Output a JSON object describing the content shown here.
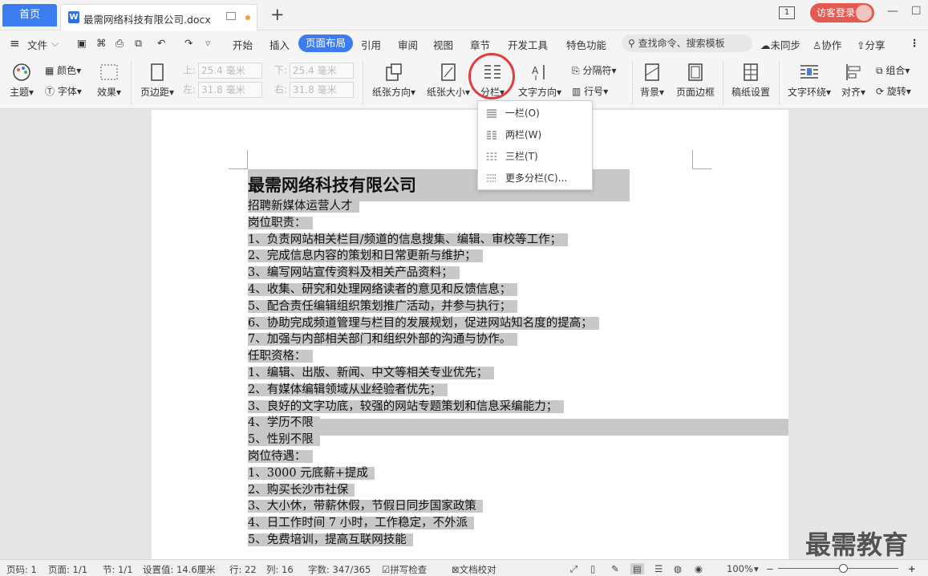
{
  "titlebar": {
    "home_tab": "首页",
    "doc_tab": "最需网络科技有限公司.docx",
    "new_tab": "+",
    "page_indicator": "1",
    "login": "访客登录"
  },
  "menubar": {
    "file": "文件",
    "items": [
      "开始",
      "插入",
      "页面布局",
      "引用",
      "审阅",
      "视图",
      "章节",
      "开发工具",
      "特色功能"
    ],
    "search": "查找命令、搜索模板",
    "sync": "未同步",
    "collab": "协作",
    "share": "分享"
  },
  "ribbon": {
    "theme": "主题",
    "color": "颜色",
    "font": "字体",
    "effect": "效果",
    "margin": "页边距",
    "top_label": "上:",
    "top_val": "25.4 毫米",
    "bottom_label": "下:",
    "bottom_val": "25.4 毫米",
    "left_label": "左:",
    "left_val": "31.8 毫米",
    "right_label": "右:",
    "right_val": "31.8 毫米",
    "orientation": "纸张方向",
    "size": "纸张大小",
    "columns": "分栏",
    "text_direction": "文字方向",
    "separator": "分隔符",
    "line_num": "行号",
    "background": "背景",
    "page_border": "页面边框",
    "draft": "稿纸设置",
    "wrap": "文字环绕",
    "align": "对齐",
    "group": "组合",
    "rotate": "旋转"
  },
  "dropdown": {
    "items": [
      "一栏(O)",
      "两栏(W)",
      "三栏(T)",
      "更多分栏(C)..."
    ]
  },
  "document": {
    "title": "最需网络科技有限公司",
    "lines": [
      "招聘新媒体运营人才",
      "岗位职责：",
      "1、负责网站相关栏目/频道的信息搜集、编辑、审校等工作；",
      "2、完成信息内容的策划和日常更新与维护；",
      "3、编写网站宣传资料及相关产品资料；",
      "4、收集、研究和处理网络读者的意见和反馈信息；",
      "5、配合责任编辑组织策划推广活动，并参与执行；",
      "6、协助完成频道管理与栏目的发展规划，促进网站知名度的提高；",
      "7、加强与内部相关部门和组织外部的沟通与协作。",
      "任职资格：",
      "1、编辑、出版、新闻、中文等相关专业优先；",
      "2、有媒体编辑领域从业经验者优先；",
      "3、良好的文字功底，较强的网站专题策划和信息采编能力；",
      "4、学历不限",
      "5、性别不限",
      "岗位待遇：",
      "1、3000 元底薪+提成",
      "2、购买长沙市社保",
      "3、大小休，带薪休假，节假日同步国家政策",
      "4、日工作时间 7 小时，工作稳定，不外派",
      "5、免费培训，提高互联网技能"
    ]
  },
  "watermark": "最需教育",
  "status": {
    "page": "页码: 1",
    "pages": "页面: 1/1",
    "section": "节: 1/1",
    "setting": "设置值: 14.6厘米",
    "row": "行: 22",
    "col": "列: 16",
    "words": "字数: 347/365",
    "spell": "拼写检查",
    "proof": "文档校对",
    "zoom": "100%",
    "zoom_level": 1.0
  }
}
